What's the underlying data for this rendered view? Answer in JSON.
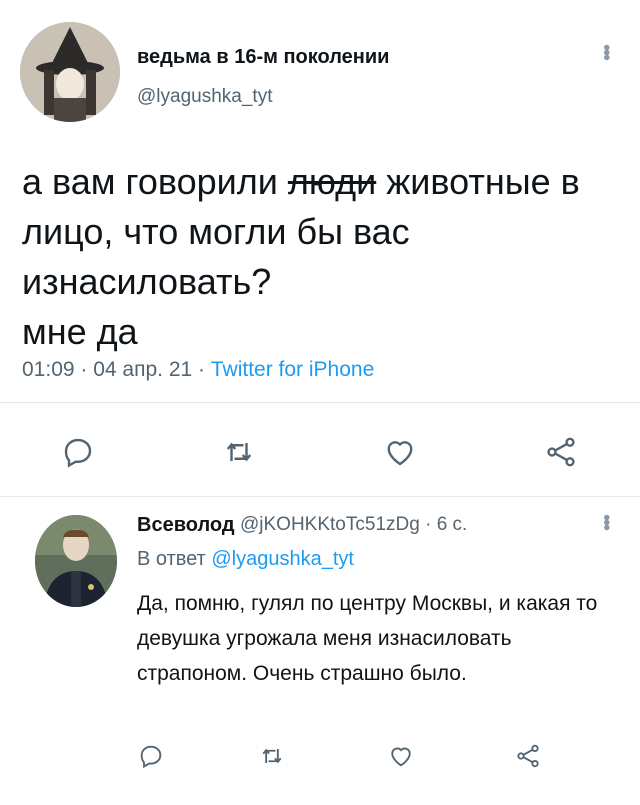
{
  "tweet": {
    "author_name": "ведьма в 16-м поколении",
    "author_handle": "@lyagushka_tyt",
    "text_before": "а вам говорили ",
    "text_struck": "люди",
    "text_after": " животные в лицо, что могли бы вас изнасиловать?",
    "text_line2": "мне да",
    "time": "01:09",
    "date": "04 апр. 21",
    "source": "Twitter for iPhone",
    "sep": " · "
  },
  "reply": {
    "author_name": "Всеволод",
    "author_handle": "@jKOHKKtoTc51zDg",
    "age": "6 с.",
    "reply_to_prefix": "В ответ ",
    "reply_to_handle": "@lyagushka_tyt",
    "text": "Да, помню, гулял по центру Москвы, и какая то девушка угрожала меня изнасиловать страпоном. Очень страшно было."
  },
  "icons": {
    "reply": "reply-icon",
    "retweet": "retweet-icon",
    "like": "heart-icon",
    "share": "share-icon",
    "more": "more-icon"
  },
  "colors": {
    "link": "#1d9bf0",
    "secondary": "#536471",
    "icon": "#536471"
  }
}
